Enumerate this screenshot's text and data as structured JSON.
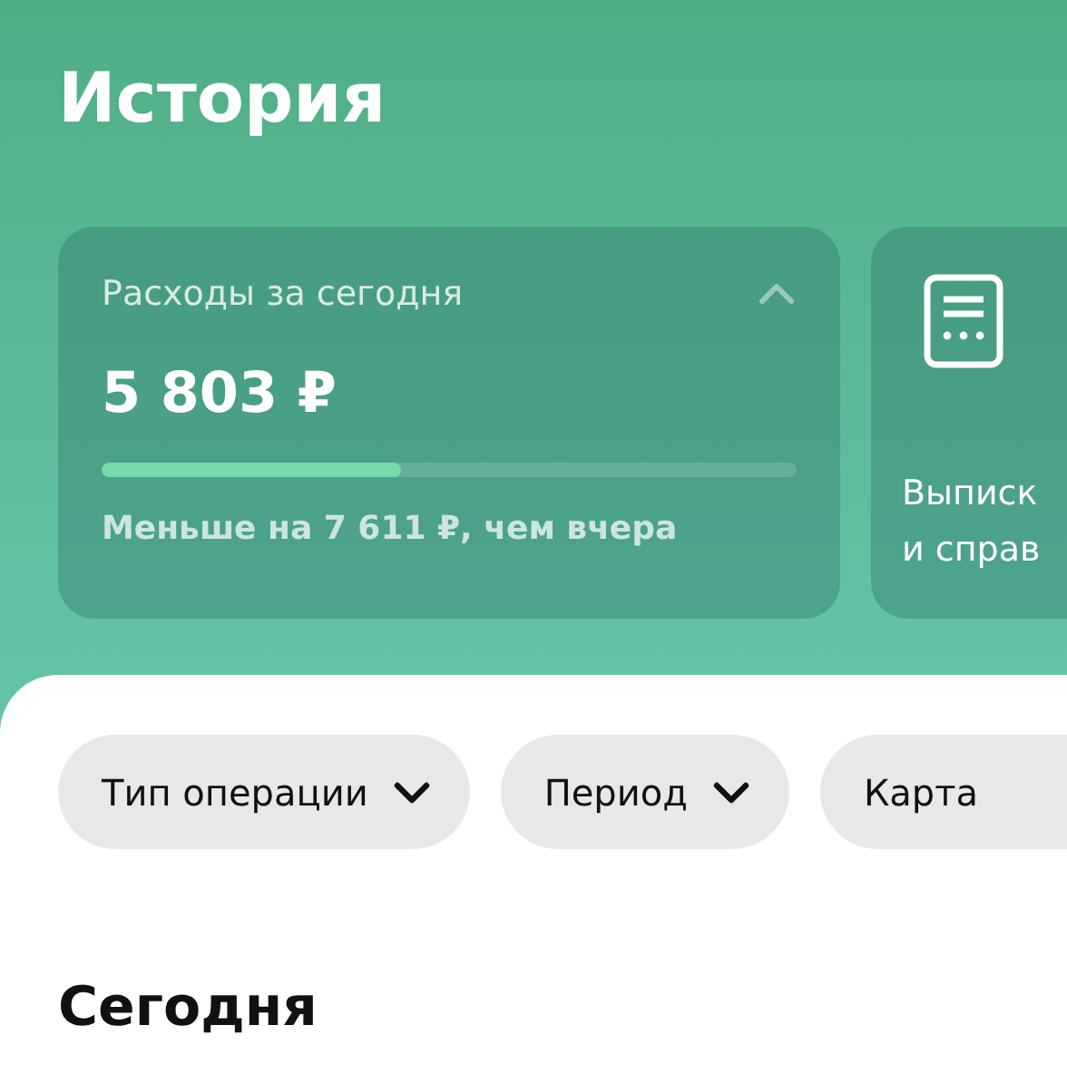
{
  "header": {
    "title": "История"
  },
  "cards": [
    {
      "kind": "spending",
      "title": "Расходы за сегодня",
      "expanded": true,
      "amount": "5 803 ₽",
      "level": 0.43,
      "note": "Меньше на 7 611 ₽, чем вчера"
    },
    {
      "kind": "statements",
      "lines": [
        "Выписк",
        "и справ"
      ]
    }
  ],
  "filters": [
    {
      "label": "Тип операции",
      "dropdown": true
    },
    {
      "label": "Период",
      "dropdown": true
    },
    {
      "label": "Карта",
      "dropdown": false
    }
  ],
  "section": {
    "title": "Сегодня"
  }
}
